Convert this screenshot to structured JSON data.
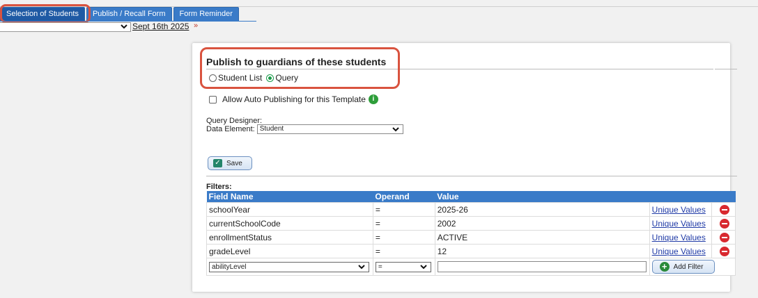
{
  "tabs": [
    {
      "label": "Selection of Students",
      "active": true
    },
    {
      "label": "Publish / Recall Form",
      "active": false
    },
    {
      "label": "Form Reminder",
      "active": false
    }
  ],
  "date": {
    "link": "Sept 16th 2025",
    "arrow": "»"
  },
  "publish": {
    "title": "Publish to guardians of these students",
    "radio_student_list": "Student List",
    "radio_query": "Query",
    "selected": "Query"
  },
  "auto_publish": {
    "label": "Allow Auto Publishing for this Template",
    "checked": false,
    "info_icon": "i"
  },
  "query_designer": {
    "label": "Query Designer:",
    "data_element_label": "Data Element:",
    "data_element_value": "Student"
  },
  "save": {
    "label": "Save"
  },
  "filters": {
    "label": "Filters:",
    "columns": [
      "Field Name",
      "Operand",
      "Value"
    ],
    "rows": [
      {
        "field": "schoolYear",
        "operand": "=",
        "value": "2025-26",
        "link": "Unique Values"
      },
      {
        "field": "currentSchoolCode",
        "operand": "=",
        "value": "2002",
        "link": "Unique Values"
      },
      {
        "field": "enrollmentStatus",
        "operand": "=",
        "value": "ACTIVE",
        "link": "Unique Values"
      },
      {
        "field": "gradeLevel",
        "operand": "=",
        "value": "12",
        "link": "Unique Values"
      }
    ],
    "new_row": {
      "field": "abilityLevel",
      "operand": "=",
      "value": "",
      "add_label": "Add Filter"
    }
  },
  "colors": {
    "tab_blue": "#3a7bc8",
    "highlight": "#d9533f",
    "remove_red": "#d8292f",
    "add_green": "#2a8a3a"
  }
}
